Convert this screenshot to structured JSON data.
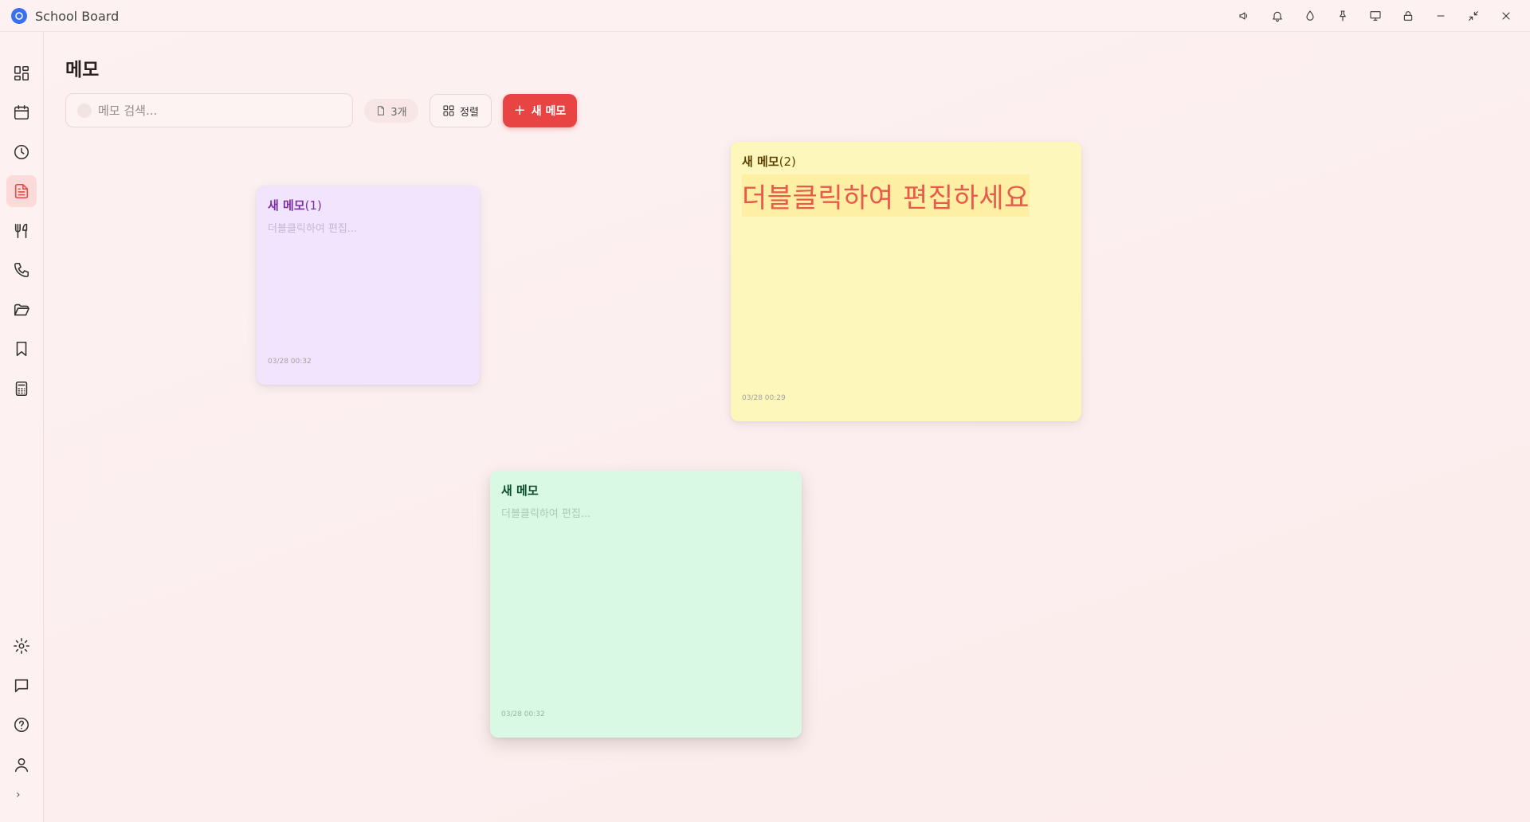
{
  "app": {
    "title": "School Board"
  },
  "titlebar": {
    "icons": [
      "megaphone-icon",
      "bell-icon",
      "droplet-icon",
      "pin-icon",
      "monitor-icon",
      "lock-icon",
      "minimize-icon",
      "restore-icon",
      "close-icon"
    ]
  },
  "sidebar": {
    "items": [
      {
        "name": "dashboard",
        "icon": "grid-icon"
      },
      {
        "name": "calendar",
        "icon": "calendar-icon"
      },
      {
        "name": "clock",
        "icon": "clock-icon"
      },
      {
        "name": "memo",
        "icon": "document-icon",
        "active": true
      },
      {
        "name": "meal",
        "icon": "utensils-icon"
      },
      {
        "name": "phone",
        "icon": "phone-icon"
      },
      {
        "name": "folder",
        "icon": "folder-icon"
      },
      {
        "name": "bookmark",
        "icon": "bookmark-icon"
      },
      {
        "name": "calculator",
        "icon": "calculator-icon"
      }
    ],
    "bottom_items": [
      {
        "name": "settings",
        "icon": "gear-icon"
      },
      {
        "name": "chat",
        "icon": "message-icon"
      },
      {
        "name": "help",
        "icon": "help-icon"
      },
      {
        "name": "profile",
        "icon": "user-icon"
      }
    ],
    "expand_label": "›"
  },
  "main": {
    "title": "메모",
    "search": {
      "placeholder": "메모 검색...",
      "value": ""
    },
    "count_label": "3개",
    "sort_label": "정렬",
    "new_button": {
      "plus": "+",
      "label": "새 메모"
    }
  },
  "memos": [
    {
      "title": "새 메모",
      "title_suffix": "(1)",
      "body": "더블클릭하여 편집...",
      "date": "03/28 00:32",
      "color": "#f1e4fc"
    },
    {
      "title": "새 메모",
      "title_suffix": "(2)",
      "body": "더블클릭하여 편집하세요",
      "date": "03/28 00:29",
      "color": "#fef7bc"
    },
    {
      "title": "새 메모",
      "title_suffix": "",
      "body": "더블클릭하여 편집...",
      "date": "03/28 00:32",
      "color": "#d9f9e5"
    }
  ],
  "colors": {
    "accent": "#e94444",
    "active_bg": "#fbdada"
  }
}
